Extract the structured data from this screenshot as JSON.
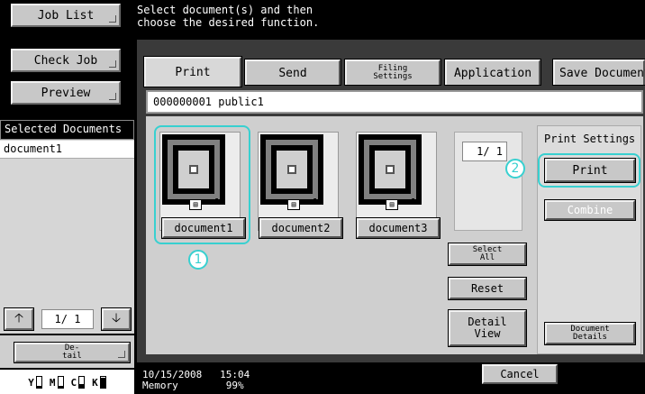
{
  "left": {
    "job_list": "Job List",
    "check_job": "Check Job",
    "preview": "Preview",
    "selected_header": "Selected Documents",
    "selected_items": [
      "document1"
    ],
    "page_count": "1/  1",
    "detail_line1": "De-",
    "detail_line2": "tail",
    "toner": [
      {
        "label": "Y",
        "level": 0.15
      },
      {
        "label": "M",
        "level": 0.15
      },
      {
        "label": "C",
        "level": 0.3
      },
      {
        "label": "K",
        "level": 0.9
      }
    ]
  },
  "message": "Select document(s) and then\nchoose the desired function.",
  "tabs": {
    "print": "Print",
    "send": "Send",
    "filing_line1": "Filing",
    "filing_line2": "Settings",
    "application": "Application",
    "save_document": "Save Document"
  },
  "box_header": "000000001  public1",
  "documents": [
    {
      "name": "document1",
      "pages": "1",
      "selected": true
    },
    {
      "name": "document2",
      "pages": "1",
      "selected": false
    },
    {
      "name": "document3",
      "pages": "1",
      "selected": false
    }
  ],
  "page_indicator": "1/  1",
  "buttons": {
    "select_all_line1": "Select",
    "select_all_line2": "All",
    "reset": "Reset",
    "detail_view_line1": "Detail",
    "detail_view_line2": "View",
    "print_settings_label": "Print Settings",
    "print": "Print",
    "combine": "Combine",
    "document_details_line1": "Document",
    "document_details_line2": "Details",
    "cancel": "Cancel"
  },
  "callouts": {
    "one": "1",
    "two": "2"
  },
  "status": {
    "date": "10/15/2008",
    "time": "15:04",
    "memory_label": "Memory",
    "memory_value": "99%"
  },
  "colors": {
    "callout": "#38d0d0"
  }
}
